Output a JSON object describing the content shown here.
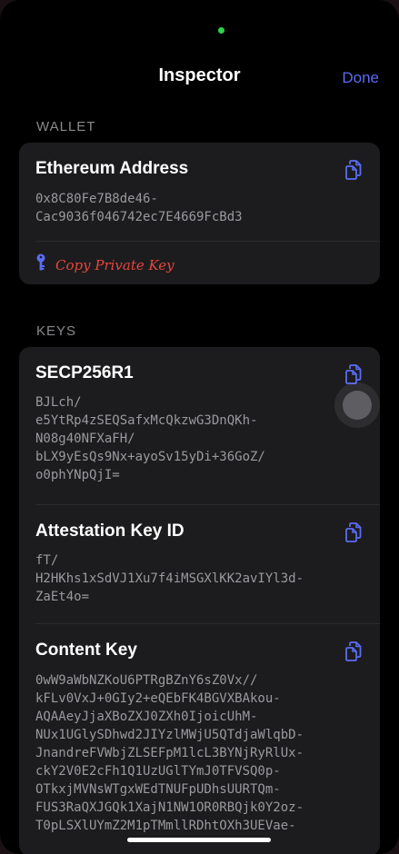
{
  "nav": {
    "title": "Inspector",
    "done_label": "Done"
  },
  "wallet": {
    "section_label": "WALLET",
    "ethereum_address": {
      "title": "Ethereum Address",
      "value_lines": [
        "0x8C80Fe7B8de46-",
        "Cac9036f046742ec7E4669FcBd3"
      ]
    },
    "copy_private_key_label": "Copy Private Key"
  },
  "keys": {
    "section_label": "KEYS",
    "items": [
      {
        "title": "SECP256R1",
        "value_lines": [
          "BJLch/",
          "e5YtRp4zSEQSafxMcQkzwG3DnQKh-",
          "N08g40NFXaFH/",
          "bLX9yEsQs9Nx+ayoSv15yDi+36GoZ/",
          "o0phYNpQjI="
        ]
      },
      {
        "title": "Attestation Key ID",
        "value_lines": [
          "fT/",
          "H2HKhs1xSdVJ1Xu7f4iMSGXlKK2avIYl3d-",
          "ZaEt4o="
        ]
      },
      {
        "title": "Content Key",
        "value_lines": [
          "0wW9aWbNZKoU6PTRgBZnY6sZ0Vx//",
          "kFLv0VxJ+0GIy2+eQEbFK4BGVXBAkou-",
          "AQAAeyJjaXBoZXJ0ZXh0IjoicUhM-",
          "NUx1UGlySDhwd2JIYzlMWjU5QTdjaWlqbD-",
          "JnandreFVWbjZLSEFpM1lcL3BYNjRyRlUx-",
          "ckY2V0E2cFh1Q1UzUGlTYmJ0TFVSQ0p-",
          "OTkxjMVNsWTgxWEdTNUFpUDhsUURTQm-",
          "FUS3RaQXJGQk1XajN1NW1OR0RBQjk0Y2oz-",
          "T0pLSXlUYmZ2M1pTMmllRDhtOXh3UEVae-"
        ]
      }
    ]
  },
  "colors": {
    "accent": "#5b6cf2",
    "danger": "#e8453c",
    "card_bg": "#1c1c1e",
    "secondary_text": "#9a9a9e"
  }
}
